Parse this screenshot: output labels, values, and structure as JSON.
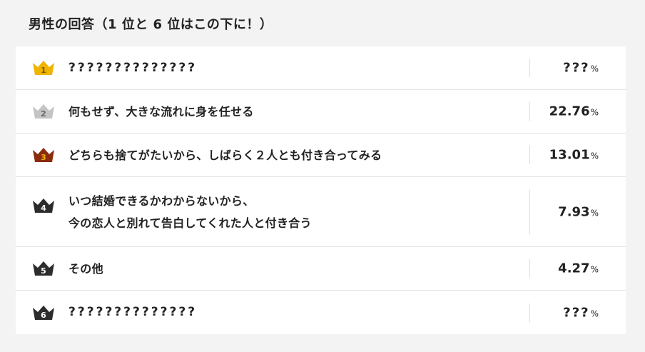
{
  "heading": "男性の回答（1 位と 6 位はこの下に！）",
  "colors": {
    "gold": "#f0b400",
    "silver": "#c4c4c4",
    "bronze": "#8a2b0e",
    "dark": "#2c2c2c"
  },
  "rows": [
    {
      "rank": "1",
      "crown_icon": "gold-crown-icon",
      "answer": "??????????????",
      "value": "???",
      "unit": "%"
    },
    {
      "rank": "2",
      "crown_icon": "silver-crown-icon",
      "answer": "何もせず、大きな流れに身を任せる",
      "value": "22.76",
      "unit": "%"
    },
    {
      "rank": "3",
      "crown_icon": "bronze-crown-icon",
      "answer": "どちらも捨てがたいから、しばらく２人とも付き合ってみる",
      "value": "13.01",
      "unit": "%"
    },
    {
      "rank": "4",
      "crown_icon": "dark-crown-icon",
      "answer_line1": "いつ結婚できるかわからないから、",
      "answer_line2": "今の恋人と別れて告白してくれた人と付き合う",
      "value": "7.93",
      "unit": "%"
    },
    {
      "rank": "5",
      "crown_icon": "dark-crown-icon",
      "answer": "その他",
      "value": "4.27",
      "unit": "%"
    },
    {
      "rank": "6",
      "crown_icon": "dark-crown-icon",
      "answer": "??????????????",
      "value": "???",
      "unit": "%"
    }
  ]
}
